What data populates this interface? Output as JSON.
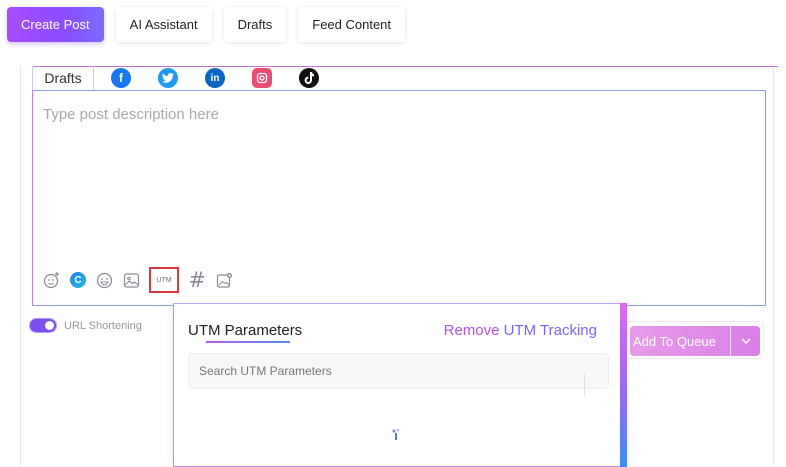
{
  "top_tabs": [
    {
      "label": "Create Post",
      "active": true
    },
    {
      "label": "AI Assistant",
      "active": false
    },
    {
      "label": "Drafts",
      "active": false
    },
    {
      "label": "Feed Content",
      "active": false
    }
  ],
  "network_tabs": {
    "drafts_label": "Drafts",
    "icons": [
      "facebook-icon",
      "twitter-icon",
      "linkedin-icon",
      "instagram-icon",
      "tiktok-icon"
    ]
  },
  "editor": {
    "placeholder": "Type post description here",
    "toolbar_icons": [
      "ai-caption-icon",
      "copilot-icon",
      "emoji-icon",
      "image-icon",
      "utm-icon",
      "hashtag-icon",
      "media-library-icon"
    ],
    "utm_icon_text": "UTM"
  },
  "url_shortening": {
    "label": "URL Shortening",
    "enabled": true
  },
  "queue": {
    "label": "Add To Queue"
  },
  "utm_panel": {
    "title": "UTM Parameters",
    "remove_part1": "Remove",
    "remove_part2": "UTM Tracking",
    "search_placeholder": "Search UTM Parameters"
  },
  "colors": {
    "accent": "#8a4dff",
    "accent_pink": "#d97fe6",
    "utm_highlight": "#d8393b"
  }
}
